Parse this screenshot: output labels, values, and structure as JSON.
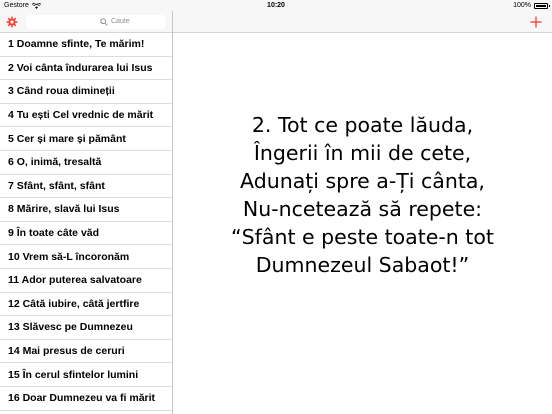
{
  "status_bar": {
    "carrier": "Gestore",
    "time": "10:20",
    "battery": "100%",
    "battery_level": 1.0
  },
  "sidebar": {
    "settings_icon": "gear-icon",
    "search_placeholder": "Caute",
    "items": [
      "1 Doamne sfinte, Te mărim!",
      "2 Voi cânta îndurarea lui Isus",
      "3 Când roua dimineții",
      "4 Tu ești Cel vrednic de mărit",
      "5 Cer și mare și pământ",
      "6 O, inimă, tresaltă",
      "7 Sfânt, sfânt, sfânt",
      "8 Mărire, slavă lui Isus",
      "9 În toate câte văd",
      "10 Vrem să-L încoronăm",
      "11 Ador puterea salvatoare",
      "12 Câtă iubire, câtă jertfire",
      "13 Slăvesc pe Dumnezeu",
      "14 Mai presus de ceruri",
      "15 În cerul sfintelor lumini",
      "16 Doar Dumnezeu va fi mărit"
    ]
  },
  "toolbar": {
    "add_icon": "plus-icon",
    "accent": "#ff3b30"
  },
  "verse": {
    "lines": [
      "2. Tot ce poate lăuda,",
      "Îngerii în mii de cete,",
      "Adunați spre a-Ți cânta,",
      "Nu-ncetează să repete:",
      "“Sfânt e peste toate-n tot",
      "Dumnezeul Sabaot!”"
    ]
  }
}
